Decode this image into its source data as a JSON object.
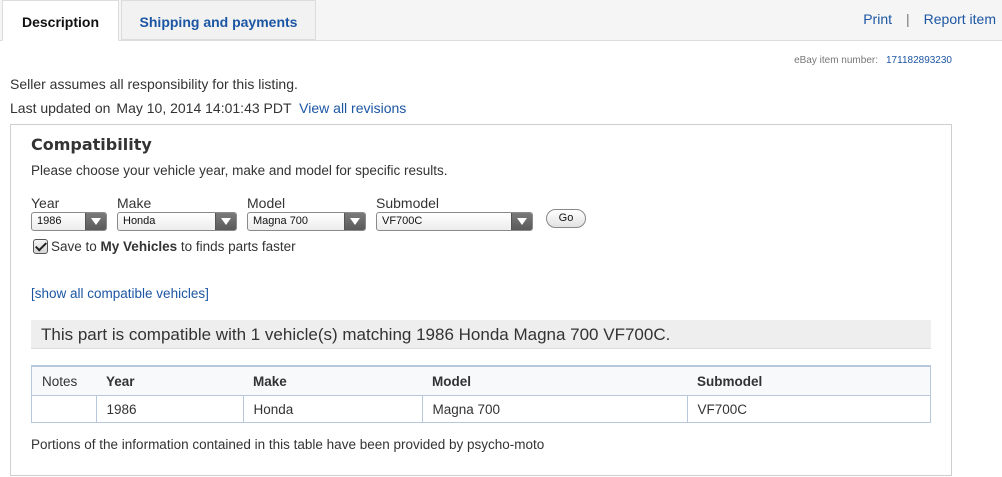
{
  "tabs": {
    "description": "Description",
    "shipping": "Shipping and payments"
  },
  "top_links": {
    "print": "Print",
    "separator": "|",
    "report": "Report item"
  },
  "item_number": {
    "label": "eBay item number:",
    "value": "171182893230"
  },
  "seller_note": "Seller assumes all responsibility for this listing.",
  "last_updated": {
    "label": "Last updated on",
    "date": "May 10, 2014 14:01:43 PDT",
    "link": "View all revisions"
  },
  "compatibility": {
    "title": "Compatibility",
    "instructions": "Please choose your vehicle year, make and model for specific results.",
    "selects": {
      "year": {
        "label": "Year",
        "value": "1986"
      },
      "make": {
        "label": "Make",
        "value": "Honda"
      },
      "model": {
        "label": "Model",
        "value": "Magna 700"
      },
      "submodel": {
        "label": "Submodel",
        "value": "VF700C"
      }
    },
    "go_label": "Go",
    "save": {
      "prefix": "Save to",
      "bold": "My Vehicles",
      "suffix": "to finds parts faster",
      "checked": true
    },
    "show_all": "[show all compatible vehicles]",
    "match_text": "This part is compatible with 1 vehicle(s) matching 1986 Honda Magna 700 VF700C.",
    "table": {
      "headers": [
        "Notes",
        "Year",
        "Make",
        "Model",
        "Submodel"
      ],
      "rows": [
        [
          "",
          "1986",
          "Honda",
          "Magna 700",
          "VF700C"
        ]
      ]
    },
    "portions": "Portions of the information contained in this table have been provided by psycho-moto"
  }
}
